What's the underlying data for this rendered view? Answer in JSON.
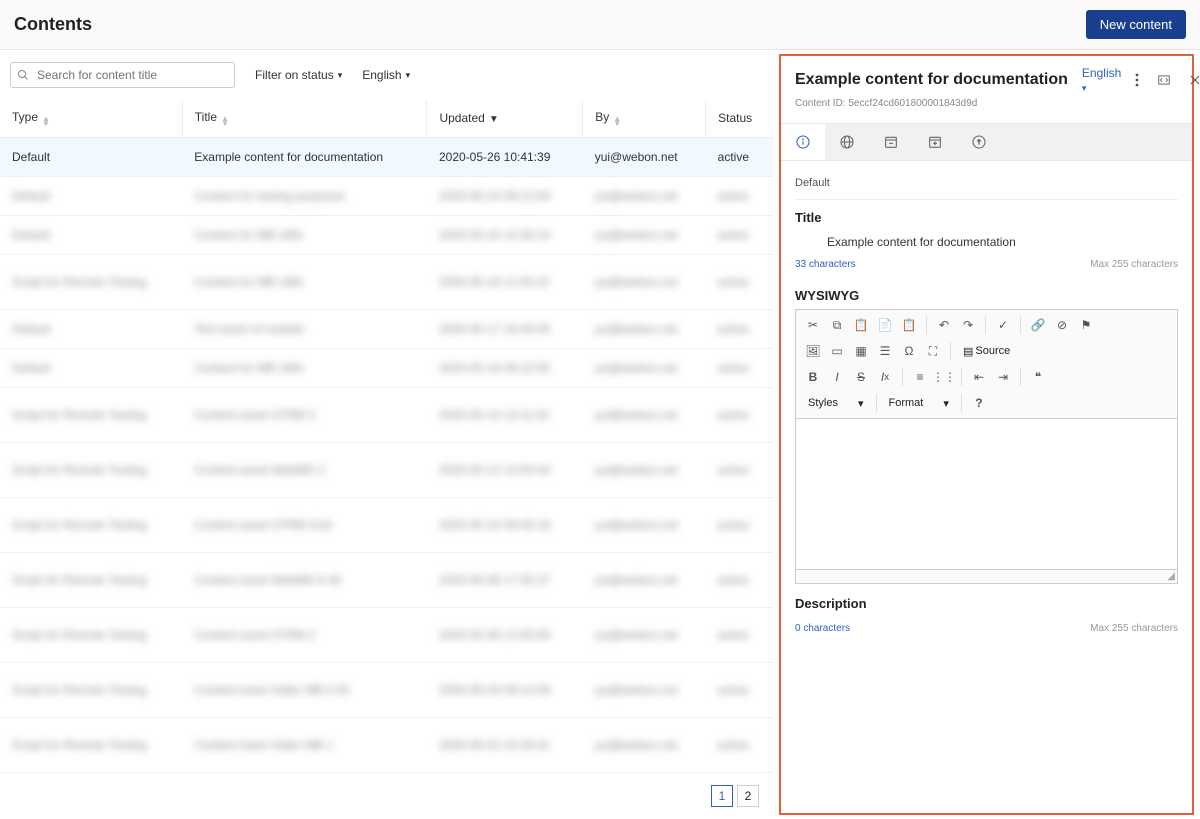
{
  "header": {
    "title": "Contents",
    "new_button": "New content"
  },
  "filters": {
    "search_placeholder": "Search for content title",
    "filter_status": "Filter on status",
    "language": "English"
  },
  "table": {
    "columns": {
      "type": "Type",
      "title": "Title",
      "updated": "Updated",
      "by": "By",
      "status": "Status"
    },
    "active_row": {
      "type": "Default",
      "title": "Example content for documentation",
      "updated": "2020-05-26 10:41:39",
      "by": "yui@webon.net",
      "status": "active"
    }
  },
  "pagination": {
    "p1": "1",
    "p2": "2"
  },
  "panel": {
    "title": "Example content for documentation",
    "language": "English",
    "content_id_label": "Content ID: 5eccf24cd601800001843d9d",
    "section": "Default",
    "title_field_label": "Title",
    "title_field_value": "Example content for documentation",
    "title_chars": "33 characters",
    "max_chars": "Max 255 characters",
    "wysiwyg_label": "WYSIWYG",
    "styles": "Styles",
    "format": "Format",
    "source": "Source",
    "description_label": "Description",
    "desc_chars": "0 characters"
  }
}
